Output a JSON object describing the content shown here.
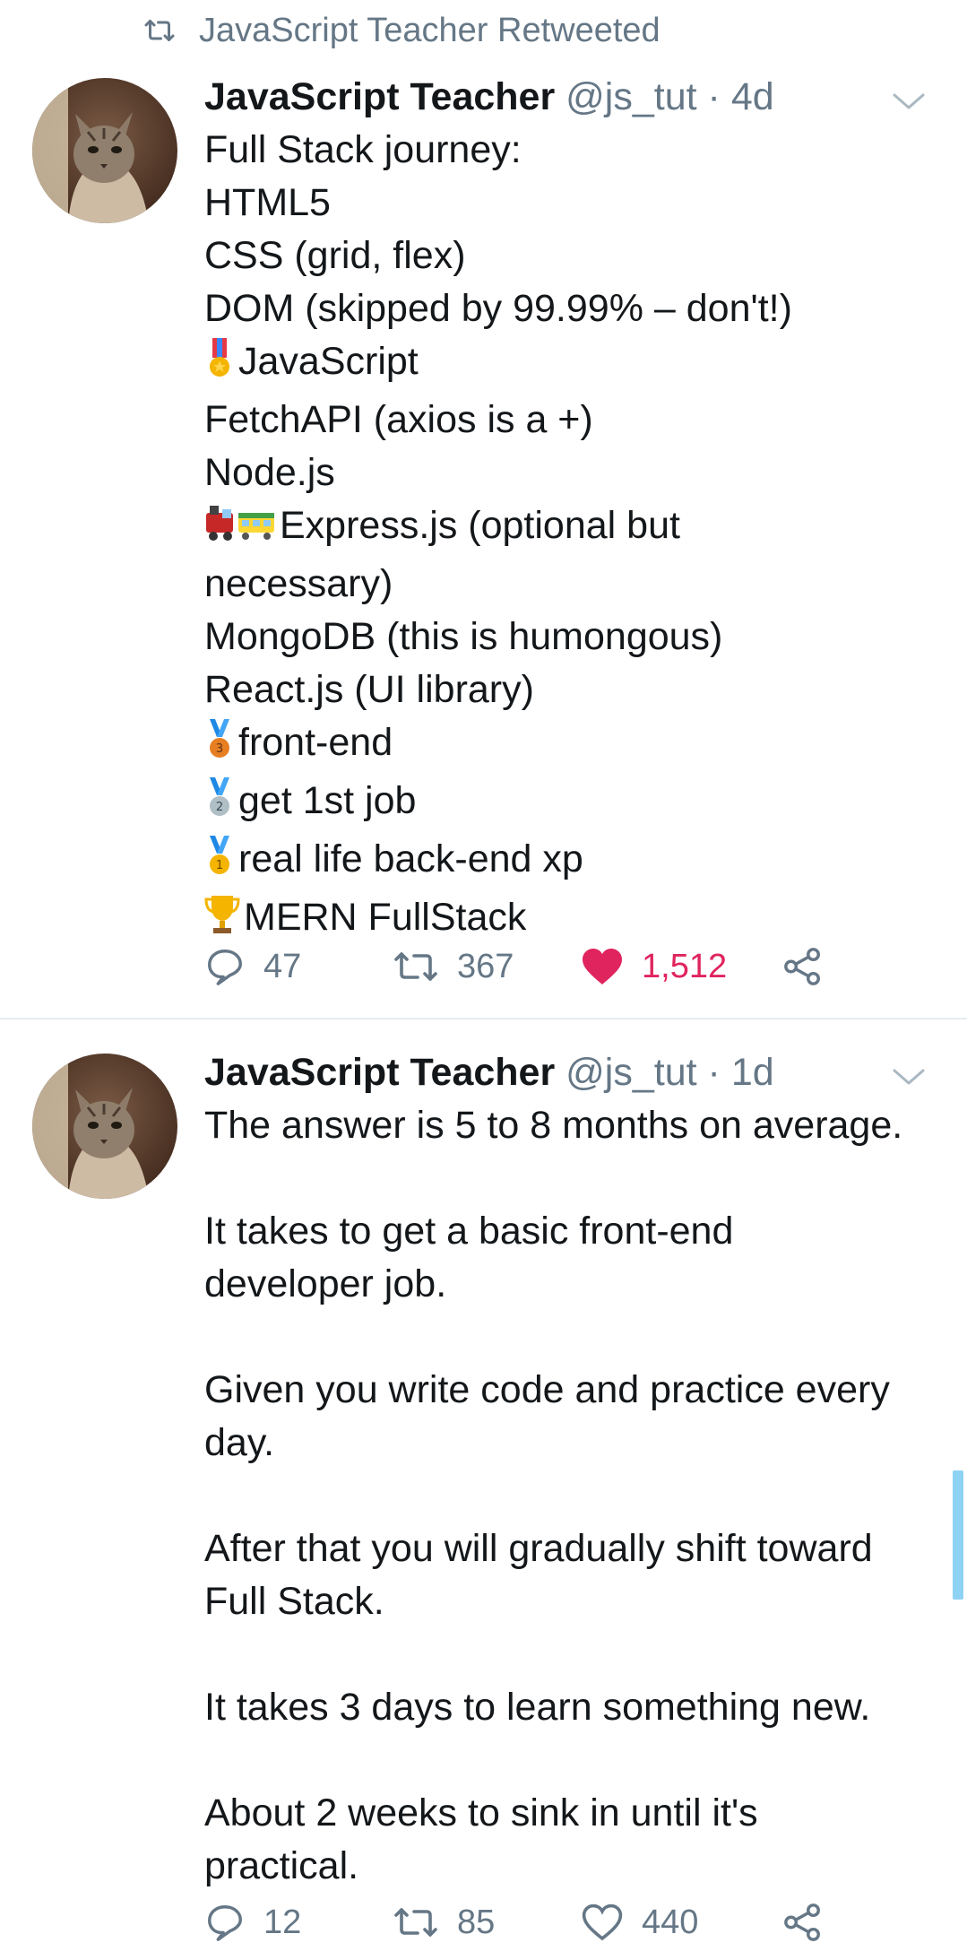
{
  "retweet_context": {
    "label": "JavaScript Teacher Retweeted",
    "icon": "retweet-icon"
  },
  "tweets": [
    {
      "author_name": "JavaScript Teacher",
      "handle": "@js_tut",
      "separator": "·",
      "time": "4d",
      "avatar": "cat-avatar",
      "lines": [
        {
          "emoji": "",
          "text": "Full Stack journey:"
        },
        {
          "emoji": "",
          "text": "HTML5"
        },
        {
          "emoji": "",
          "text": "CSS (grid, flex)"
        },
        {
          "emoji": "",
          "text": "DOM (skipped by 99.99% – don't!)"
        },
        {
          "emoji": "military-medal-emoji",
          "text": "JavaScript"
        },
        {
          "emoji": "",
          "text": "FetchAPI (axios is a +)"
        },
        {
          "emoji": "",
          "text": "Node.js"
        },
        {
          "emoji": "train-emoji",
          "text": "Express.js (optional but"
        },
        {
          "emoji": "",
          "text": "necessary)"
        },
        {
          "emoji": "",
          "text": "MongoDB (this is humongous)"
        },
        {
          "emoji": "",
          "text": "React.js (UI library)"
        },
        {
          "emoji": "3rd-place-medal-emoji",
          "text": "front-end"
        },
        {
          "emoji": "2nd-place-medal-emoji",
          "text": "get 1st job"
        },
        {
          "emoji": "1st-place-medal-emoji",
          "text": "real life back-end xp"
        },
        {
          "emoji": "trophy-emoji",
          "text": "MERN FullStack"
        }
      ],
      "reply_count": "47",
      "retweet_count": "367",
      "like_count": "1,512",
      "liked": true
    },
    {
      "author_name": "JavaScript Teacher",
      "handle": "@js_tut",
      "separator": "·",
      "time": "1d",
      "avatar": "cat-avatar",
      "lines": [
        {
          "emoji": "",
          "text": "The answer is 5 to 8 months on average."
        },
        {
          "emoji": "",
          "text": ""
        },
        {
          "emoji": "",
          "text": "It takes to get a basic front-end"
        },
        {
          "emoji": "",
          "text": "developer job."
        },
        {
          "emoji": "",
          "text": ""
        },
        {
          "emoji": "",
          "text": "Given you write code and practice every"
        },
        {
          "emoji": "",
          "text": "day."
        },
        {
          "emoji": "",
          "text": ""
        },
        {
          "emoji": "",
          "text": "After that you will gradually shift toward"
        },
        {
          "emoji": "",
          "text": "Full Stack."
        },
        {
          "emoji": "",
          "text": ""
        },
        {
          "emoji": "",
          "text": "It takes 3 days to learn something new."
        },
        {
          "emoji": "",
          "text": ""
        },
        {
          "emoji": "",
          "text": "About 2 weeks to sink in until it's"
        },
        {
          "emoji": "",
          "text": "practical."
        }
      ],
      "reply_count": "12",
      "retweet_count": "85",
      "like_count": "440",
      "liked": false
    }
  ],
  "colors": {
    "text": "#14171a",
    "secondary": "#657786",
    "like_active": "#e0245e",
    "divider": "#e6ecf0",
    "scroll_indicator": "#8fd3f4"
  }
}
